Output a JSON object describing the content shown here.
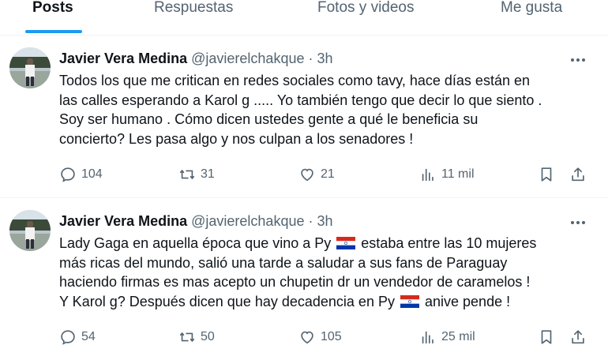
{
  "tabs": [
    {
      "label": "Posts",
      "active": true
    },
    {
      "label": "Respuestas",
      "active": false
    },
    {
      "label": "Fotos y videos",
      "active": false
    },
    {
      "label": "Me gusta",
      "active": false
    }
  ],
  "accent_color": "#1d9bf0",
  "posts": [
    {
      "author_name": "Javier Vera Medina",
      "handle": "@javierelchakque",
      "separator": "·",
      "time": "3h",
      "text_lines": [
        "Todos los que me critican en redes sociales como tavy, hace días están en",
        "las calles esperando a Karol g ..... Yo también tengo que decir lo que siento .",
        "Soy ser humano . Cómo dicen ustedes gente a qué le beneficia su",
        "concierto? Les pasa algo y nos culpan a los senadores !"
      ],
      "replies": "104",
      "reposts": "31",
      "likes": "21",
      "views": "11 mil"
    },
    {
      "author_name": "Javier Vera Medina",
      "handle": "@javierelchakque",
      "separator": "·",
      "time": "3h",
      "text_lines": [
        {
          "before": "Lady Gaga en aquella época que vino a Py",
          "flag": "paraguay-flag",
          "after": "estaba entre las 10 mujeres"
        },
        "más ricas del mundo, salió una tarde a saludar a sus fans de Paraguay",
        "haciendo firmas es mas acepto un chupetin dr un vendedor de caramelos !",
        {
          "before": "Y Karol g? Después dicen que hay decadencia en Py",
          "flag": "paraguay-flag",
          "after": "anive pende !"
        }
      ],
      "replies": "54",
      "reposts": "50",
      "likes": "105",
      "views": "25 mil"
    }
  ]
}
